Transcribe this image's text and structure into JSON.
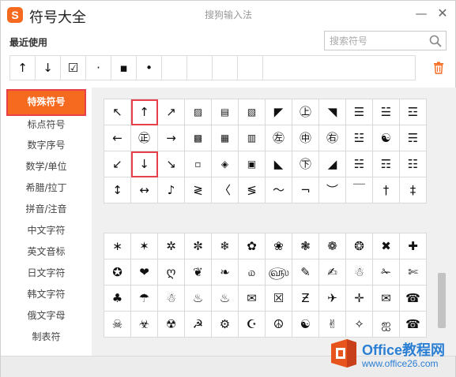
{
  "titlebar": {
    "logo_text": "S",
    "title": "符号大全",
    "ime_name": "搜狗输入法",
    "minimize_label": "—",
    "close_label": "✕"
  },
  "recent": {
    "label": "最近使用",
    "items": [
      "↑",
      "↓",
      "☑",
      "·",
      "▪",
      "•"
    ]
  },
  "search": {
    "placeholder": "搜索符号",
    "value": ""
  },
  "sidebar": {
    "items": [
      {
        "label": "特殊符号",
        "active": true
      },
      {
        "label": "标点符号"
      },
      {
        "label": "数字序号"
      },
      {
        "label": "数学/单位"
      },
      {
        "label": "希腊/拉丁"
      },
      {
        "label": "拼音/注音"
      },
      {
        "label": "中文字符"
      },
      {
        "label": "英文音标"
      },
      {
        "label": "日文字符"
      },
      {
        "label": "韩文字符"
      },
      {
        "label": "俄文字母"
      },
      {
        "label": "制表符"
      }
    ]
  },
  "grid1": [
    [
      "↖",
      "↑",
      "↗",
      "▨",
      "▤",
      "▧",
      "◤",
      "㊤",
      "◥",
      "☰",
      "☱",
      "☲"
    ],
    [
      "←",
      "㊣",
      "→",
      "▩",
      "▦",
      "▥",
      "㊧",
      "㊥",
      "㊨",
      "☳",
      "☯",
      "☴"
    ],
    [
      "↙",
      "↓",
      "↘",
      "▫",
      "◈",
      "▣",
      "◣",
      "㊦",
      "◢",
      "☵",
      "☶",
      "☷"
    ],
    [
      "↕",
      "↔",
      "♪",
      "≷",
      "〈",
      "≶",
      "〜",
      "¬",
      "︶",
      "￣",
      "†",
      "‡"
    ]
  ],
  "grid2": [
    [
      "∗",
      "✶",
      "✲",
      "✼",
      "❄",
      "✿",
      "❀",
      "❃",
      "❁",
      "❂",
      "✖",
      "✚"
    ],
    [
      "✪",
      "❤",
      "ღ",
      "❦",
      "❧",
      "௰",
      "௵",
      "✎",
      "✍",
      "☃",
      "✁",
      "✄"
    ],
    [
      "♣",
      "☂",
      "☃",
      "♨",
      "♨",
      "✉",
      "☒",
      "Ƶ",
      "✈",
      "✛",
      "✉",
      "☎"
    ],
    [
      "☠",
      "☣",
      "☢",
      "☭",
      "⚙",
      "☪",
      "☮",
      "☯",
      "✌",
      "✧",
      "ஐ",
      "☎"
    ]
  ],
  "highlighted": [
    "grid1.0.1",
    "grid1.2.1"
  ],
  "watermark": {
    "title": "Office教程网",
    "url": "www.office26.com"
  },
  "colors": {
    "accent": "#f56a1f",
    "highlight_border": "#e8404a",
    "watermark_blue": "#2a7fd4"
  }
}
